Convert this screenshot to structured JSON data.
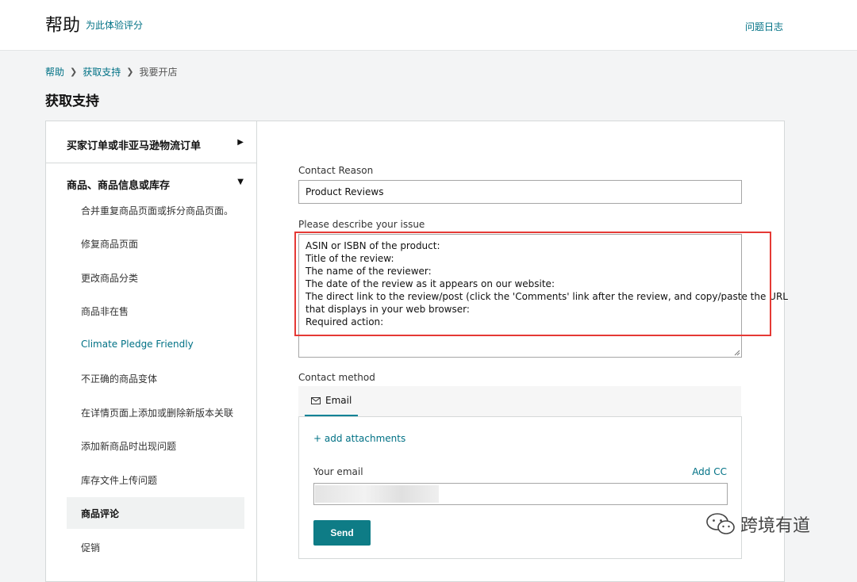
{
  "header": {
    "title": "帮助",
    "subtitle": "为此体验评分",
    "issue_log": "问题日志"
  },
  "breadcrumb": [
    "帮助",
    "获取支持",
    "我要开店"
  ],
  "page_title": "获取支持",
  "sidebar": {
    "categories": [
      {
        "label": "买家订单或非亚马逊物流订单",
        "expanded": false
      },
      {
        "label": "商品、商品信息或库存",
        "expanded": true
      }
    ],
    "items": [
      "合并重复商品页面或拆分商品页面。",
      "修复商品页面",
      "更改商品分类",
      "商品非在售",
      "Climate Pledge Friendly",
      "不正确的商品变体",
      "在详情页面上添加或删除新版本关联",
      "添加新商品时出现问题",
      "库存文件上传问题",
      "商品评论",
      "促销"
    ],
    "active_item": "商品评论"
  },
  "form": {
    "contact_reason_label": "Contact Reason",
    "contact_reason_value": "Product Reviews",
    "describe_label": "Please describe your issue",
    "describe_lines": [
      "ASIN or ISBN of the product:",
      "Title of the review:",
      "The name of the reviewer:",
      "The date of the review as it appears on our website:",
      "The direct link to the review/post (click the 'Comments' link after the review, and copy/paste the URL",
      "that displays in your web browser:",
      "Required action:"
    ],
    "contact_method_label": "Contact method",
    "email_tab": "Email",
    "add_attachments": "+ add attachments",
    "your_email_label": "Your email",
    "add_cc": "Add CC",
    "send": "Send"
  },
  "watermark": "跨境有道",
  "colors": {
    "link": "#007185",
    "button": "#0e7c86",
    "highlight": "#e53935"
  }
}
